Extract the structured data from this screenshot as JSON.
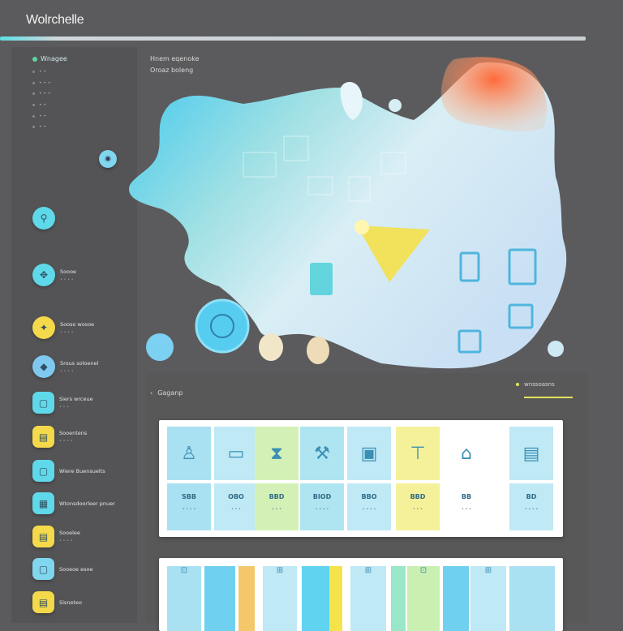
{
  "app": {
    "title": "Wolrchelle"
  },
  "sidebar": {
    "header": "Wnagee",
    "menu": [
      "• •",
      "• • •",
      "• • •",
      "• •",
      "• •",
      "• •"
    ],
    "items": [
      {
        "label": "",
        "sub": "",
        "icon": "pin-icon",
        "color": "#5fd8ea"
      },
      {
        "label": "Soooe",
        "sub": "• • • •",
        "icon": "compass-icon",
        "color": "#5fd8ea"
      },
      {
        "label": "Sooso wosoe",
        "sub": "• • • •",
        "icon": "lightbulb-icon",
        "color": "#f4d94a"
      },
      {
        "label": "Srous soloenel",
        "sub": "• • • •",
        "icon": "droplet-icon",
        "color": "#7fc9f0"
      },
      {
        "label": "Siers wrceue",
        "sub": "• • •",
        "icon": "square-icon",
        "color": "#5fd8ea"
      },
      {
        "label": "Sooentens",
        "sub": "• • • •",
        "icon": "note-icon",
        "color": "#f4d94a"
      },
      {
        "label": "Wiere Buensuelts",
        "sub": "",
        "icon": "square-icon",
        "color": "#5fd8ea"
      },
      {
        "label": "Wtonsdoorleer pnuer",
        "sub": "",
        "icon": "grid-icon",
        "color": "#5fd8ea"
      },
      {
        "label": "Sooelee",
        "sub": "• • • •",
        "icon": "note-icon",
        "color": "#f4d94a"
      },
      {
        "label": "Sooeoe esoe",
        "sub": "",
        "icon": "square-icon",
        "color": "#7fd6ee"
      },
      {
        "label": "Sisneteo",
        "sub": "",
        "icon": "note-icon",
        "color": "#f4d94a"
      }
    ]
  },
  "main": {
    "header_line1": "Hnem eqenoke",
    "header_line2": "Oroaz boleng"
  },
  "section": {
    "title": "Gaganp",
    "right_label": "wnssoasns"
  },
  "grid": {
    "columns": [
      {
        "icon": "hydrant-icon",
        "value": "SBB",
        "sub": "• • • •",
        "color": "#a9e0f2",
        "glyph": "♙"
      },
      {
        "icon": "monitor-icon",
        "value": "OBO",
        "sub": "• • •",
        "color": "#bfe9f5",
        "glyph": "▭"
      },
      {
        "icon": "hourglass-icon",
        "value": "BBD",
        "sub": "• • •",
        "color": "#d3f1b6",
        "glyph": "⧗"
      },
      {
        "icon": "hammer-icon",
        "value": "BIOD",
        "sub": "• • • •",
        "color": "#aee5f0",
        "glyph": "⚒"
      },
      {
        "icon": "frame-icon",
        "value": "BBO",
        "sub": "• • • •",
        "color": "#bfe9f5",
        "glyph": "▣"
      },
      {
        "icon": "tag-icon",
        "value": "BBD",
        "sub": "• • •",
        "color": "#f5f19a",
        "glyph": "⊤"
      },
      {
        "icon": "house-icon",
        "value": "BB",
        "sub": "• • •",
        "color": "#ffffff",
        "glyph": "⌂"
      },
      {
        "icon": "document-icon",
        "value": "BD",
        "sub": "• • • •",
        "color": "#bfe9f5",
        "glyph": "▤"
      }
    ]
  },
  "bars": {
    "columns": [
      {
        "color": "#a9e0f2",
        "glyph": "⊡"
      },
      {
        "color": "#6fd0f0",
        "glyph": ""
      },
      {
        "color": "#f4c76a",
        "glyph": ""
      },
      {
        "color": "#bfe9f5",
        "glyph": "⊞"
      },
      {
        "color": "#5fd3ef",
        "glyph": ""
      },
      {
        "color": "#f5e34a",
        "glyph": ""
      },
      {
        "color": "#bfe9f5",
        "glyph": "⊞"
      },
      {
        "color": "#9ae6c8",
        "glyph": ""
      },
      {
        "color": "#c9f0b0",
        "glyph": "⊡"
      },
      {
        "color": "#6fd0f0",
        "glyph": ""
      },
      {
        "color": "#bfe9f5",
        "glyph": "⊞"
      },
      {
        "color": "#a9e0f2",
        "glyph": ""
      }
    ]
  }
}
